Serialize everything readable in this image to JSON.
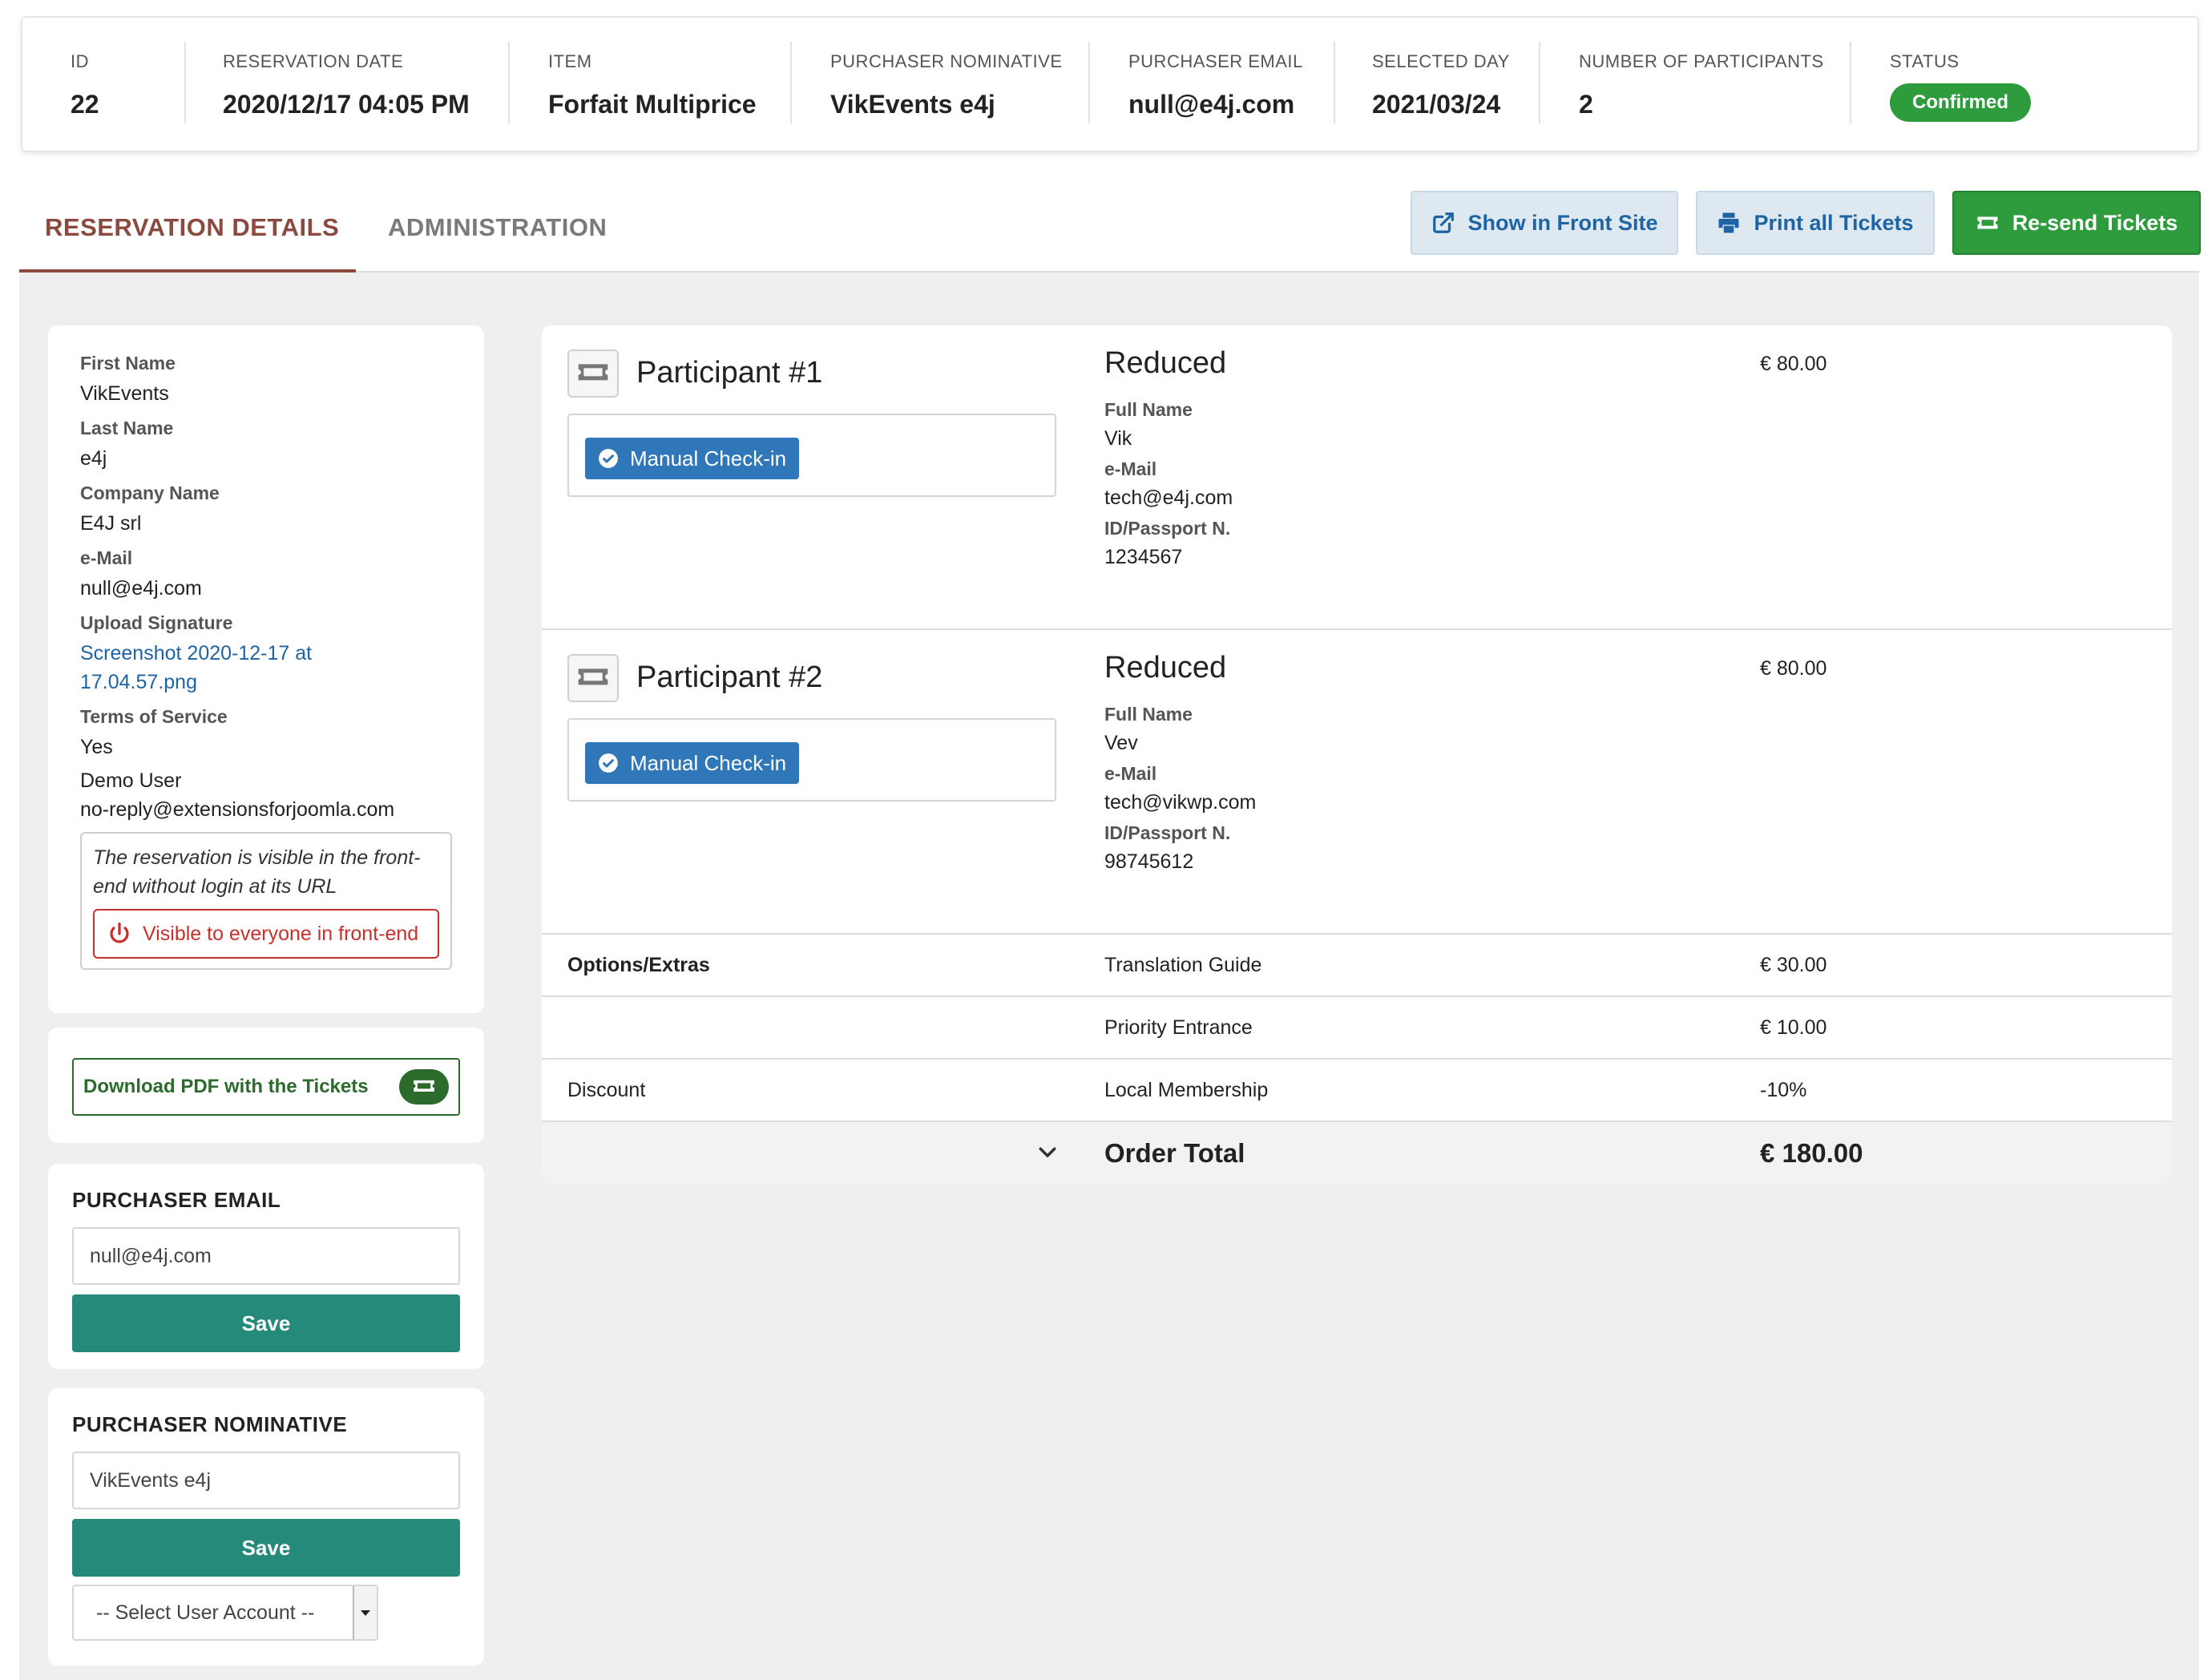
{
  "summary": {
    "id_label": "ID",
    "id_value": "22",
    "date_label": "RESERVATION DATE",
    "date_value": "2020/12/17 04:05 PM",
    "item_label": "ITEM",
    "item_value": "Forfait Multiprice",
    "nominative_label": "PURCHASER NOMINATIVE",
    "nominative_value": "VikEvents e4j",
    "email_label": "PURCHASER EMAIL",
    "email_value": "null@e4j.com",
    "day_label": "SELECTED DAY",
    "day_value": "2021/03/24",
    "participants_label": "NUMBER OF PARTICIPANTS",
    "participants_value": "2",
    "status_label": "STATUS",
    "status_value": "Confirmed"
  },
  "tabs": {
    "details": "RESERVATION DETAILS",
    "administration": "ADMINISTRATION"
  },
  "actions": {
    "show_front": "Show in Front Site",
    "print_tickets": "Print all Tickets",
    "resend_tickets": "Re-send Tickets"
  },
  "info": {
    "first_name_label": "First Name",
    "first_name": "VikEvents",
    "last_name_label": "Last Name",
    "last_name": "e4j",
    "company_label": "Company Name",
    "company": "E4J srl",
    "email_label": "e-Mail",
    "email": "null@e4j.com",
    "signature_label": "Upload Signature",
    "signature_line1": "Screenshot 2020-12-17 at",
    "signature_line2": "17.04.57.png",
    "terms_label": "Terms of Service",
    "terms": "Yes",
    "demo_user": "Demo User",
    "demo_email": "no-reply@extensionsforjoomla.com",
    "visibility_note_line1": "The reservation is visible in the front-",
    "visibility_note_line2": "end without login at its URL",
    "visible_button": "Visible to everyone in front-end"
  },
  "download": {
    "label": "Download PDF with the Tickets"
  },
  "purchaser_email": {
    "title": "PURCHASER EMAIL",
    "value": "null@e4j.com",
    "save": "Save"
  },
  "purchaser_nominative": {
    "title": "PURCHASER NOMINATIVE",
    "value": "VikEvents e4j",
    "save": "Save",
    "select_placeholder": "-- Select User Account --"
  },
  "participants": [
    {
      "title": "Participant #1",
      "checkin": "Manual Check-in",
      "type": "Reduced",
      "price": "€ 80.00",
      "full_name_label": "Full Name",
      "full_name": "Vik",
      "email_label": "e-Mail",
      "email": "tech@e4j.com",
      "passport_label": "ID/Passport N.",
      "passport": "1234567"
    },
    {
      "title": "Participant #2",
      "checkin": "Manual Check-in",
      "type": "Reduced",
      "price": "€ 80.00",
      "full_name_label": "Full Name",
      "full_name": "Vev",
      "email_label": "e-Mail",
      "email": "tech@vikwp.com",
      "passport_label": "ID/Passport N.",
      "passport": "98745612"
    }
  ],
  "options": {
    "label": "Options/Extras",
    "items": [
      {
        "name": "Translation Guide",
        "price": "€ 30.00"
      },
      {
        "name": "Priority Entrance",
        "price": "€ 10.00"
      }
    ]
  },
  "discount": {
    "label": "Discount",
    "name": "Local Membership",
    "value": "-10%"
  },
  "total": {
    "label": "Order Total",
    "value": "€ 180.00"
  },
  "colors": {
    "accent_tab": "#8b4a3f",
    "confirmed": "#2e9b3c",
    "link": "#1e64a5",
    "save": "#258a7a",
    "checkin": "#2f77b8",
    "danger": "#c9302c",
    "download": "#2b6b2b"
  },
  "icons": {
    "front_site": "external-link-icon",
    "print": "printer-icon",
    "resend": "ticket-icon",
    "participant": "ticket-icon",
    "checkin": "check-circle-icon",
    "visible": "power-icon",
    "expand": "chevron-down-icon"
  }
}
